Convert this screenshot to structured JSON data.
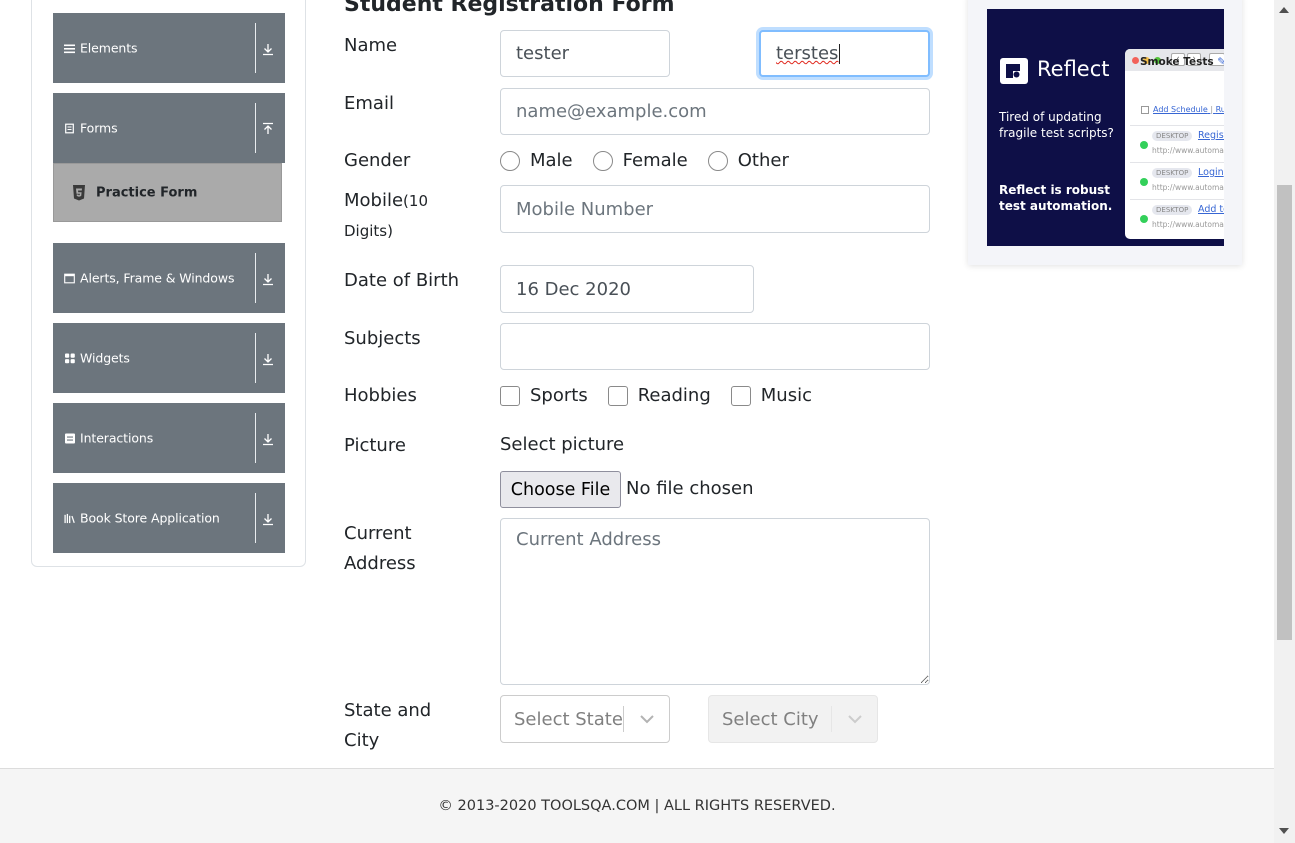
{
  "sidebar": {
    "groups": [
      {
        "label": "Elements",
        "icon": "menu-icon",
        "expanded": false
      },
      {
        "label": "Forms",
        "icon": "document-icon",
        "expanded": true
      },
      {
        "label": "Alerts, Frame & Windows",
        "icon": "window-icon",
        "expanded": false
      },
      {
        "label": "Widgets",
        "icon": "grid-icon",
        "expanded": false
      },
      {
        "label": "Interactions",
        "icon": "list-icon",
        "expanded": false
      },
      {
        "label": "Book Store Application",
        "icon": "books-icon",
        "expanded": false
      }
    ],
    "active_item": {
      "label": "Practice Form",
      "icon": "html5-icon"
    }
  },
  "form": {
    "title": "Student Registration Form",
    "name_label": "Name",
    "first_name_value": "tester",
    "last_name_value": "terstes",
    "email_label": "Email",
    "email_placeholder": "name@example.com",
    "gender_label": "Gender",
    "gender_options": [
      "Male",
      "Female",
      "Other"
    ],
    "mobile_label": "Mobile",
    "mobile_hint": "(10",
    "mobile_hint_2": "Digits)",
    "mobile_placeholder": "Mobile Number",
    "dob_label": "Date of Birth",
    "dob_value": "16 Dec 2020",
    "subjects_label": "Subjects",
    "hobbies_label": "Hobbies",
    "hobby_options": [
      "Sports",
      "Reading",
      "Music"
    ],
    "picture_label": "Picture",
    "picture_select_text": "Select picture",
    "file_button_label": "Choose File",
    "file_status": "No file chosen",
    "address_label_1": "Current",
    "address_label_2": "Address",
    "address_placeholder": "Current Address",
    "state_city_label_1": "State and",
    "state_city_label_2": "City",
    "state_placeholder": "Select State",
    "city_placeholder": "Select City"
  },
  "ad": {
    "brand": "Reflect",
    "line1": "Tired of updating fragile test scripts?",
    "line2": "Reflect is robust test automation.",
    "window_title": "Smoke Tests",
    "schedule_link": "Add Schedule",
    "schedule_extra": "Ru",
    "rows": [
      {
        "tag": "DESKTOP",
        "link": "Registr",
        "url": "http://www.automat"
      },
      {
        "tag": "DESKTOP",
        "link": "Login",
        "url": "http://www.automat"
      },
      {
        "tag": "DESKTOP",
        "link": "Add to",
        "url": "http://www.automat"
      }
    ]
  },
  "footer": {
    "text": "© 2013-2020 TOOLSQA.COM | ALL RIGHTS RESERVED."
  },
  "colors": {
    "sidebar_group": "#6c757d",
    "active_item": "#aaaaaa",
    "focus_border": "#80bdff",
    "ad_background": "#0e0f47"
  }
}
